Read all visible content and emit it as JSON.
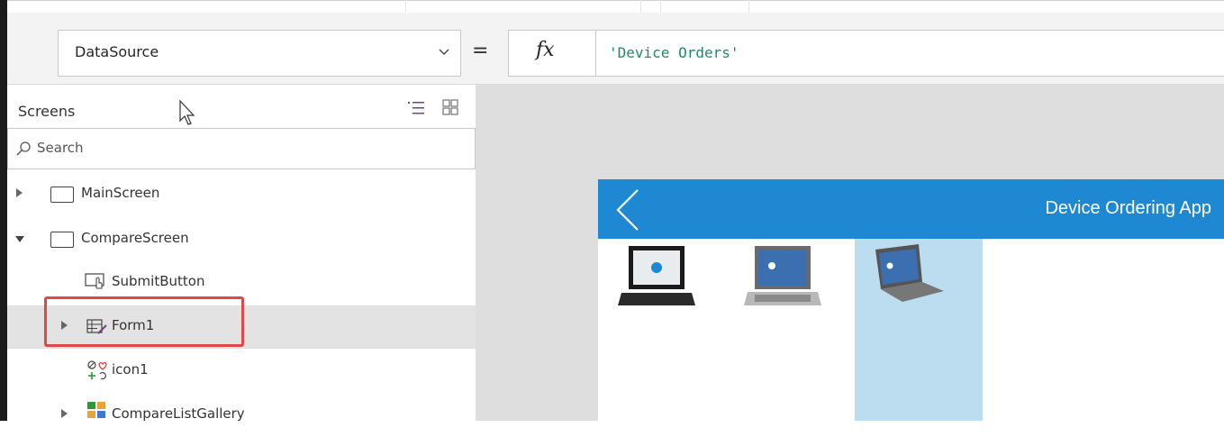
{
  "formula_bar": {
    "property": "DataSource",
    "equals": "=",
    "fx": "fx",
    "formula": "'Device Orders'"
  },
  "tree_view": {
    "header": "Screens",
    "search_placeholder": "Search",
    "items": [
      {
        "label": "MainScreen",
        "icon": "screen-icon",
        "expander": "collapsed"
      },
      {
        "label": "CompareScreen",
        "icon": "screen-icon",
        "expander": "expanded"
      },
      {
        "label": "SubmitButton",
        "icon": "button-icon",
        "expander": "none"
      },
      {
        "label": "Form1",
        "icon": "form-icon",
        "expander": "collapsed",
        "selected": true
      },
      {
        "label": "icon1",
        "icon": "icons-control-icon",
        "expander": "none"
      },
      {
        "label": "CompareListGallery",
        "icon": "gallery-icon",
        "expander": "collapsed"
      }
    ]
  },
  "app_preview": {
    "title": "Device Ordering App",
    "header_color": "#1e88d2",
    "selected_item_color": "#bcdcf0",
    "laptops": [
      "laptop-hp-black-icon",
      "laptop-hp-elitebook-icon",
      "laptop-hp-probook-icon"
    ]
  },
  "colors": {
    "formula_text": "#1d8a6b",
    "highlight_border": "#e04848",
    "selected_row": "#e3e3e3"
  }
}
